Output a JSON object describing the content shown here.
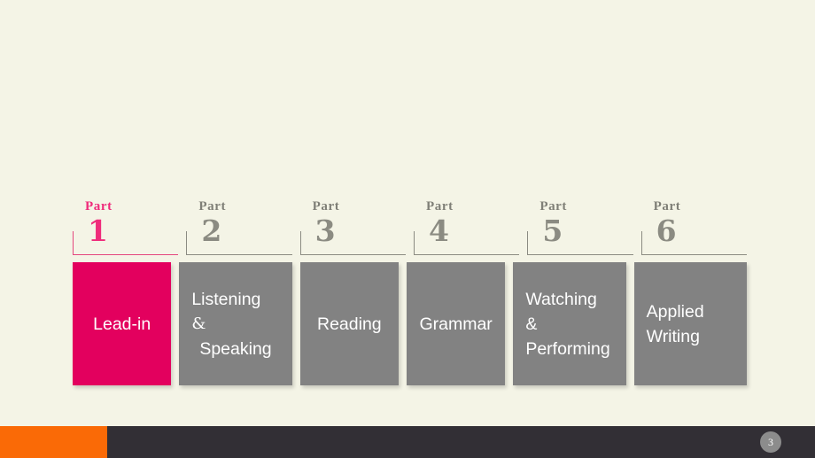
{
  "slide": {
    "background_color": "#f4f4e6",
    "accent_color": "#e3005e",
    "accent_text_color": "#ef2b7b",
    "muted_color": "#828282",
    "part_word_label": "Part"
  },
  "parts": [
    {
      "word": "Part",
      "number": "1",
      "active": true
    },
    {
      "word": "Part",
      "number": "2",
      "active": false
    },
    {
      "word": "Part",
      "number": "3",
      "active": false
    },
    {
      "word": "Part",
      "number": "4",
      "active": false
    },
    {
      "word": "Part",
      "number": "5",
      "active": false
    },
    {
      "word": "Part",
      "number": "6",
      "active": false
    }
  ],
  "cards": [
    {
      "id": "lead-in",
      "align": "center",
      "accent": true,
      "lines": [
        {
          "text": "Lead-in",
          "style": "plain"
        }
      ]
    },
    {
      "id": "listening-speaking",
      "align": "left",
      "accent": false,
      "lines": [
        {
          "text": "Listening",
          "style": "plain"
        },
        {
          "text": "&",
          "style": "amp-serif"
        },
        {
          "text": "Speaking",
          "style": "indent"
        }
      ]
    },
    {
      "id": "reading",
      "align": "center",
      "accent": false,
      "lines": [
        {
          "text": "Reading",
          "style": "plain"
        }
      ]
    },
    {
      "id": "grammar",
      "align": "center",
      "accent": false,
      "lines": [
        {
          "text": "Grammar",
          "style": "plain"
        }
      ]
    },
    {
      "id": "watching-performing",
      "align": "left",
      "accent": false,
      "lines": [
        {
          "text": "Watching",
          "style": "plain"
        },
        {
          "text": "&",
          "style": "plain"
        },
        {
          "text": "Performing",
          "style": "plain"
        }
      ]
    },
    {
      "id": "applied-writing",
      "align": "left",
      "accent": false,
      "lines": [
        {
          "text": "Applied",
          "style": "plain"
        },
        {
          "text": "Writing",
          "style": "plain"
        }
      ]
    }
  ],
  "footer": {
    "page_number": "3",
    "bar_color": "#322f35",
    "accent_block_color": "#fa6a06",
    "badge_color": "#8c8c8c"
  }
}
